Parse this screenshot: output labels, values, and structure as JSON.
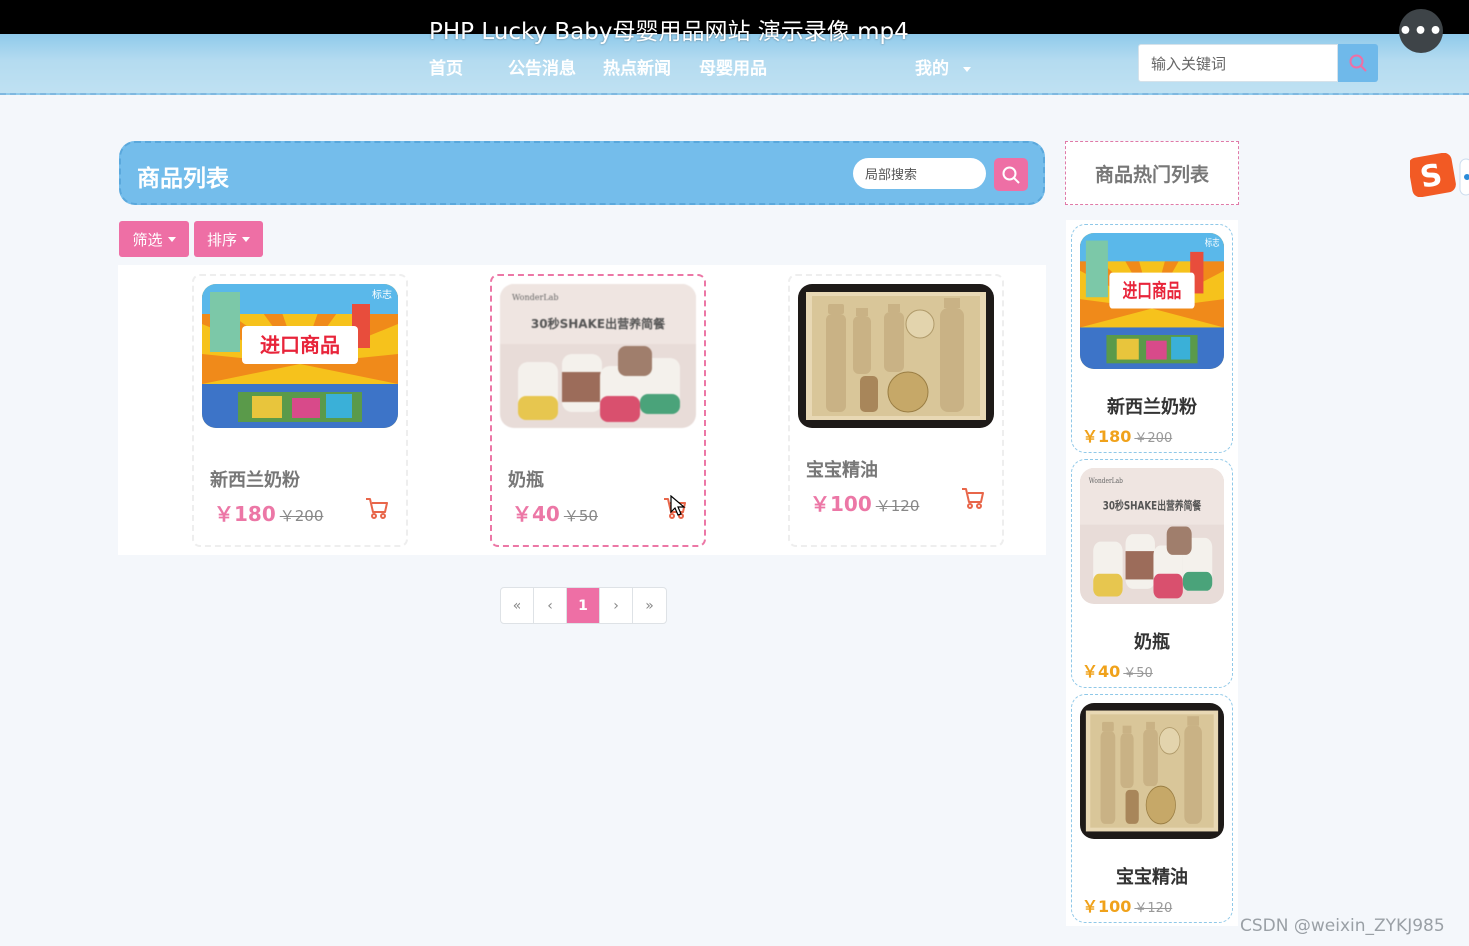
{
  "video": {
    "title": "PHP Lucky Baby母婴用品网站 演示录像.mp4",
    "more_label": "•••"
  },
  "nav": {
    "items": [
      "首页",
      "公告消息",
      "热点新闻",
      "母婴用品"
    ],
    "account_label": "我的",
    "search_placeholder": "输入关键词"
  },
  "list": {
    "title": "商品列表",
    "local_search_placeholder": "局部搜索",
    "filter_label": "筛选",
    "sort_label": "排序"
  },
  "products": [
    {
      "name": "新西兰奶粉",
      "price": "￥180",
      "old_price": "￥200",
      "image": "imported-goods-poster"
    },
    {
      "name": "奶瓶",
      "price": "￥40",
      "old_price": "￥50",
      "image": "shake-bottles-photo"
    },
    {
      "name": "宝宝精油",
      "price": "￥100",
      "old_price": "￥120",
      "image": "gold-skincare-set-photo"
    }
  ],
  "pagination": {
    "first": "«",
    "prev": "‹",
    "current": "1",
    "next": "›",
    "last": "»"
  },
  "hot": {
    "title": "商品热门列表",
    "items": [
      {
        "name": "新西兰奶粉",
        "price": "￥180",
        "old_price": "￥200"
      },
      {
        "name": "奶瓶",
        "price": "￥40",
        "old_price": "￥50"
      },
      {
        "name": "宝宝精油",
        "price": "￥100",
        "old_price": "￥120"
      }
    ]
  },
  "watermark": "CSDN @weixin_ZYKJ985",
  "colors": {
    "pink": "#ee6fa5",
    "blue": "#74bdeb",
    "orange_price": "#f0a21b",
    "cart": "#e8664a"
  },
  "icons": [
    "search-icon",
    "cart-icon",
    "caret-down-icon",
    "sogou-logo-icon",
    "mouse-cursor-icon"
  ]
}
